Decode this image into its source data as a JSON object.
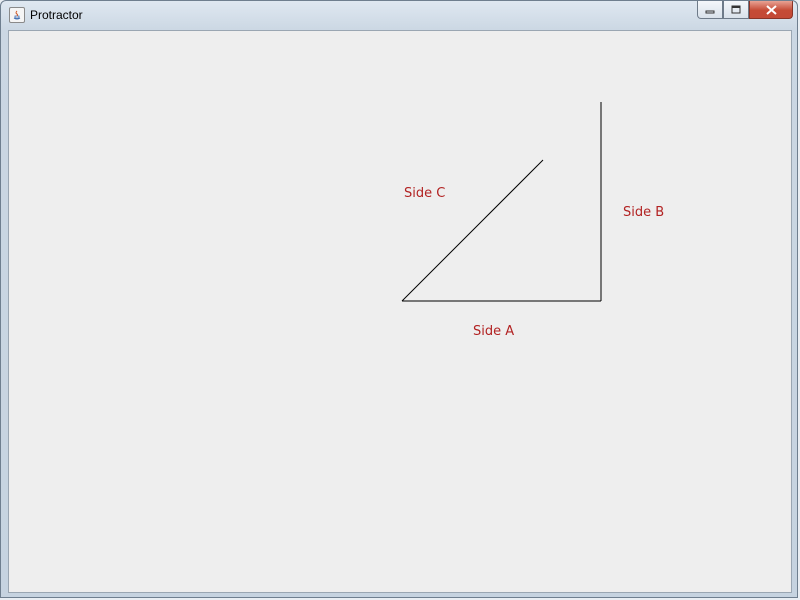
{
  "window": {
    "title": "Protractor"
  },
  "titlebar_buttons": {
    "minimize_icon": "minimize-icon",
    "maximize_icon": "maximize-icon",
    "close_icon": "close-icon"
  },
  "canvas": {
    "labels": {
      "side_a": "Side A",
      "side_b": "Side B",
      "side_c": "Side C"
    },
    "label_color": "#b22222",
    "line_color": "#000000"
  }
}
